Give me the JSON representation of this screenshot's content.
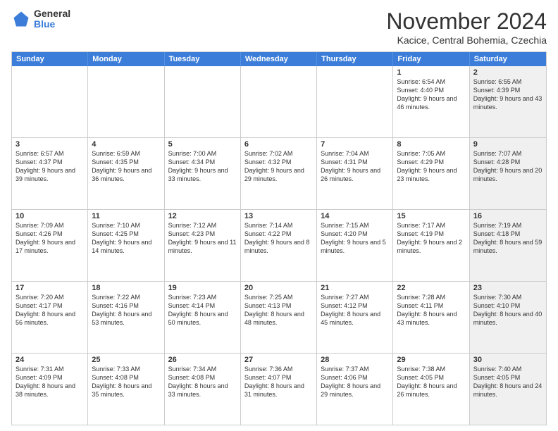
{
  "logo": {
    "general": "General",
    "blue": "Blue"
  },
  "title": "November 2024",
  "location": "Kacice, Central Bohemia, Czechia",
  "days_of_week": [
    "Sunday",
    "Monday",
    "Tuesday",
    "Wednesday",
    "Thursday",
    "Friday",
    "Saturday"
  ],
  "weeks": [
    [
      {
        "day": "",
        "info": "",
        "shaded": false
      },
      {
        "day": "",
        "info": "",
        "shaded": false
      },
      {
        "day": "",
        "info": "",
        "shaded": false
      },
      {
        "day": "",
        "info": "",
        "shaded": false
      },
      {
        "day": "",
        "info": "",
        "shaded": false
      },
      {
        "day": "1",
        "info": "Sunrise: 6:54 AM\nSunset: 4:40 PM\nDaylight: 9 hours and 46 minutes.",
        "shaded": false
      },
      {
        "day": "2",
        "info": "Sunrise: 6:55 AM\nSunset: 4:39 PM\nDaylight: 9 hours and 43 minutes.",
        "shaded": true
      }
    ],
    [
      {
        "day": "3",
        "info": "Sunrise: 6:57 AM\nSunset: 4:37 PM\nDaylight: 9 hours and 39 minutes.",
        "shaded": false
      },
      {
        "day": "4",
        "info": "Sunrise: 6:59 AM\nSunset: 4:35 PM\nDaylight: 9 hours and 36 minutes.",
        "shaded": false
      },
      {
        "day": "5",
        "info": "Sunrise: 7:00 AM\nSunset: 4:34 PM\nDaylight: 9 hours and 33 minutes.",
        "shaded": false
      },
      {
        "day": "6",
        "info": "Sunrise: 7:02 AM\nSunset: 4:32 PM\nDaylight: 9 hours and 29 minutes.",
        "shaded": false
      },
      {
        "day": "7",
        "info": "Sunrise: 7:04 AM\nSunset: 4:31 PM\nDaylight: 9 hours and 26 minutes.",
        "shaded": false
      },
      {
        "day": "8",
        "info": "Sunrise: 7:05 AM\nSunset: 4:29 PM\nDaylight: 9 hours and 23 minutes.",
        "shaded": false
      },
      {
        "day": "9",
        "info": "Sunrise: 7:07 AM\nSunset: 4:28 PM\nDaylight: 9 hours and 20 minutes.",
        "shaded": true
      }
    ],
    [
      {
        "day": "10",
        "info": "Sunrise: 7:09 AM\nSunset: 4:26 PM\nDaylight: 9 hours and 17 minutes.",
        "shaded": false
      },
      {
        "day": "11",
        "info": "Sunrise: 7:10 AM\nSunset: 4:25 PM\nDaylight: 9 hours and 14 minutes.",
        "shaded": false
      },
      {
        "day": "12",
        "info": "Sunrise: 7:12 AM\nSunset: 4:23 PM\nDaylight: 9 hours and 11 minutes.",
        "shaded": false
      },
      {
        "day": "13",
        "info": "Sunrise: 7:14 AM\nSunset: 4:22 PM\nDaylight: 9 hours and 8 minutes.",
        "shaded": false
      },
      {
        "day": "14",
        "info": "Sunrise: 7:15 AM\nSunset: 4:20 PM\nDaylight: 9 hours and 5 minutes.",
        "shaded": false
      },
      {
        "day": "15",
        "info": "Sunrise: 7:17 AM\nSunset: 4:19 PM\nDaylight: 9 hours and 2 minutes.",
        "shaded": false
      },
      {
        "day": "16",
        "info": "Sunrise: 7:19 AM\nSunset: 4:18 PM\nDaylight: 8 hours and 59 minutes.",
        "shaded": true
      }
    ],
    [
      {
        "day": "17",
        "info": "Sunrise: 7:20 AM\nSunset: 4:17 PM\nDaylight: 8 hours and 56 minutes.",
        "shaded": false
      },
      {
        "day": "18",
        "info": "Sunrise: 7:22 AM\nSunset: 4:16 PM\nDaylight: 8 hours and 53 minutes.",
        "shaded": false
      },
      {
        "day": "19",
        "info": "Sunrise: 7:23 AM\nSunset: 4:14 PM\nDaylight: 8 hours and 50 minutes.",
        "shaded": false
      },
      {
        "day": "20",
        "info": "Sunrise: 7:25 AM\nSunset: 4:13 PM\nDaylight: 8 hours and 48 minutes.",
        "shaded": false
      },
      {
        "day": "21",
        "info": "Sunrise: 7:27 AM\nSunset: 4:12 PM\nDaylight: 8 hours and 45 minutes.",
        "shaded": false
      },
      {
        "day": "22",
        "info": "Sunrise: 7:28 AM\nSunset: 4:11 PM\nDaylight: 8 hours and 43 minutes.",
        "shaded": false
      },
      {
        "day": "23",
        "info": "Sunrise: 7:30 AM\nSunset: 4:10 PM\nDaylight: 8 hours and 40 minutes.",
        "shaded": true
      }
    ],
    [
      {
        "day": "24",
        "info": "Sunrise: 7:31 AM\nSunset: 4:09 PM\nDaylight: 8 hours and 38 minutes.",
        "shaded": false
      },
      {
        "day": "25",
        "info": "Sunrise: 7:33 AM\nSunset: 4:08 PM\nDaylight: 8 hours and 35 minutes.",
        "shaded": false
      },
      {
        "day": "26",
        "info": "Sunrise: 7:34 AM\nSunset: 4:08 PM\nDaylight: 8 hours and 33 minutes.",
        "shaded": false
      },
      {
        "day": "27",
        "info": "Sunrise: 7:36 AM\nSunset: 4:07 PM\nDaylight: 8 hours and 31 minutes.",
        "shaded": false
      },
      {
        "day": "28",
        "info": "Sunrise: 7:37 AM\nSunset: 4:06 PM\nDaylight: 8 hours and 29 minutes.",
        "shaded": false
      },
      {
        "day": "29",
        "info": "Sunrise: 7:38 AM\nSunset: 4:05 PM\nDaylight: 8 hours and 26 minutes.",
        "shaded": false
      },
      {
        "day": "30",
        "info": "Sunrise: 7:40 AM\nSunset: 4:05 PM\nDaylight: 8 hours and 24 minutes.",
        "shaded": true
      }
    ]
  ]
}
